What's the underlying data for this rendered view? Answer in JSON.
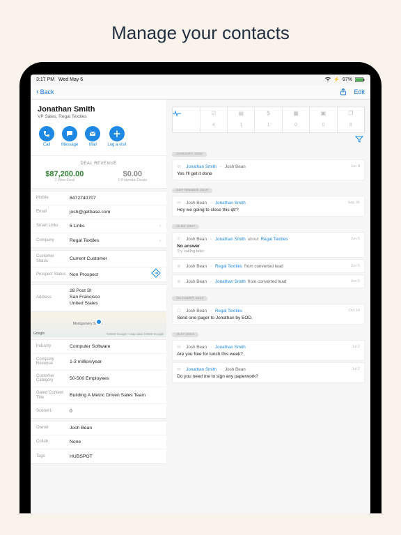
{
  "promo": {
    "title": "Manage your contacts"
  },
  "status_bar": {
    "time": "3:17 PM",
    "date": "Wed May 6",
    "battery": "97%"
  },
  "nav": {
    "back": "Back",
    "edit": "Edit"
  },
  "contact": {
    "name": "Jonathan Smith",
    "subtitle": "VP Sales, Regal Textiles"
  },
  "actions": {
    "call": "Call",
    "message": "Message",
    "mail": "Mail",
    "log_visit": "Log a visit"
  },
  "deals": {
    "heading": "DEAL REVENUE",
    "won_amount": "$87,200.00",
    "won_sub": "1 Won Deal",
    "potential_amount": "$0.00",
    "potential_sub": "0 Potential Deals"
  },
  "details1": {
    "mobile_label": "Mobile",
    "mobile": "8472740707",
    "email_label": "Email",
    "email": "josh@getbase.com",
    "smart_label": "Smart Links",
    "smart": "6 Links",
    "company_label": "Company",
    "company": "Regal Textiles"
  },
  "details2": {
    "cust_status_label": "Customer Status",
    "cust_status": "Current Customer",
    "prospect_status_label": "Prospect Status",
    "prospect_status": "Non Prospect"
  },
  "address": {
    "label": "Address",
    "line1": "28 Post St",
    "line2": "San Francisco",
    "line3": "United States",
    "map_label": "Montgomery Street",
    "map_google": "Google",
    "map_attr": "©2020 Google • Map data ©2020 Google"
  },
  "details3": {
    "industry_label": "Industry",
    "industry": "Computer Software",
    "revenue_label": "Company Revenue",
    "revenue": "1-3 million/year",
    "category_label": "Customer Category",
    "category": "50-500 Employees",
    "gated_label": "Gated Content Title",
    "gated": "Building A Metric Driven Sales Team",
    "score_label": "Score#1",
    "score": "0"
  },
  "details4": {
    "owner_label": "Owner",
    "owner": "Josh Bean",
    "collab_label": "Collab.",
    "collab": "None",
    "tags_label": "Tags",
    "tags": "HUBSPOT"
  },
  "tabs": {
    "counts": [
      "",
      "4",
      "1",
      "1",
      "0",
      "0",
      "8"
    ]
  },
  "timeline": {
    "pill_jan2020": "JANUARY 2020",
    "i1": {
      "from": "Jonathan Smith",
      "to": "Josh Bean",
      "date": "Jan 8",
      "body": "Yes I'll get it done"
    },
    "pill_sep2019": "SEPTEMBER 2019",
    "i2": {
      "from": "Josh Bean",
      "to": "Jonathan Smith",
      "date": "Sep 26",
      "body": "Hey we going to close this qtr?"
    },
    "pill_jun2017": "JUNE 2017",
    "i3": {
      "from": "Josh Bean",
      "to": "Jonathan Smith",
      "about_label": "about",
      "about": "Regal Textiles",
      "date": "Jun 5",
      "subject": "No answer",
      "sub": "Try calling later"
    },
    "i4": {
      "from": "Josh Bean",
      "to": "Regal Textiles",
      "date": "Jun 5",
      "suffix": "from converted lead"
    },
    "i5": {
      "from": "Josh Bean",
      "to": "Jonathan Smith",
      "date": "Jun 5",
      "suffix": "from converted lead"
    },
    "pill_oct2014": "OCTOBER 2014",
    "i6": {
      "from": "Josh Bean",
      "to": "Regal Textiles",
      "date": "Oct 14",
      "body": "Send one-pager to Jonathan by EOD."
    },
    "pill_jul2014": "JULY 2014",
    "i7": {
      "from": "Josh Bean",
      "to": "Jonathan Smith",
      "date": "Jul 2",
      "body": "Are you free for lunch this week?"
    },
    "i8": {
      "from": "Jonathan Smith",
      "to": "Josh Bean",
      "date": "Jul 2",
      "body": "Do you need me to sign any paperwork?"
    }
  }
}
